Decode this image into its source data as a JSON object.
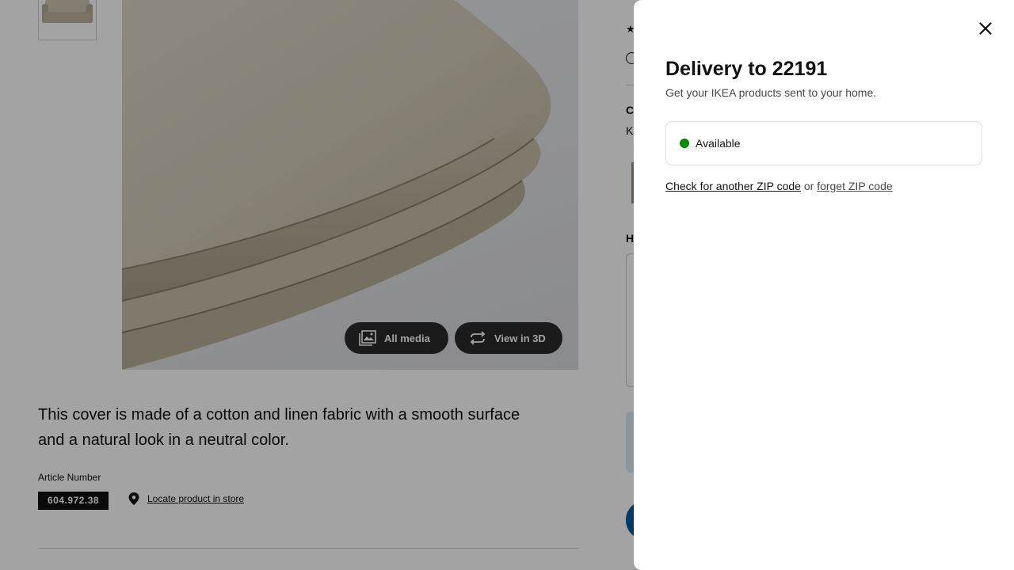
{
  "product": {
    "description": "This cover is made of a cotton and linen fabric with a smooth surface and a natural look in a neutral color.",
    "article_label": "Article Number",
    "article_number": "604.972.38",
    "locate_label": "Locate product in store",
    "media_buttons": {
      "all_media": "All media",
      "view_3d": "View in 3D"
    }
  },
  "right_column": {
    "section_c_initial": "C",
    "section_k_initial": "K",
    "section_h_initial": "H",
    "star_icon": "star-icon",
    "info_icon": "info-icon"
  },
  "delivery_panel": {
    "title": "Delivery to 22191",
    "subtitle": "Get your IKEA products sent to your home.",
    "availability": {
      "status": "Available",
      "status_color": "#0a8a00"
    },
    "check_zip_link": "Check for another ZIP code",
    "or_text": "or",
    "forget_zip_link": "forget ZIP code",
    "close_icon": "close-icon"
  },
  "colors": {
    "overlay": "rgba(0,0,0,0.36)",
    "ikea_blue": "#0058a3",
    "article_badge": "#111111"
  }
}
